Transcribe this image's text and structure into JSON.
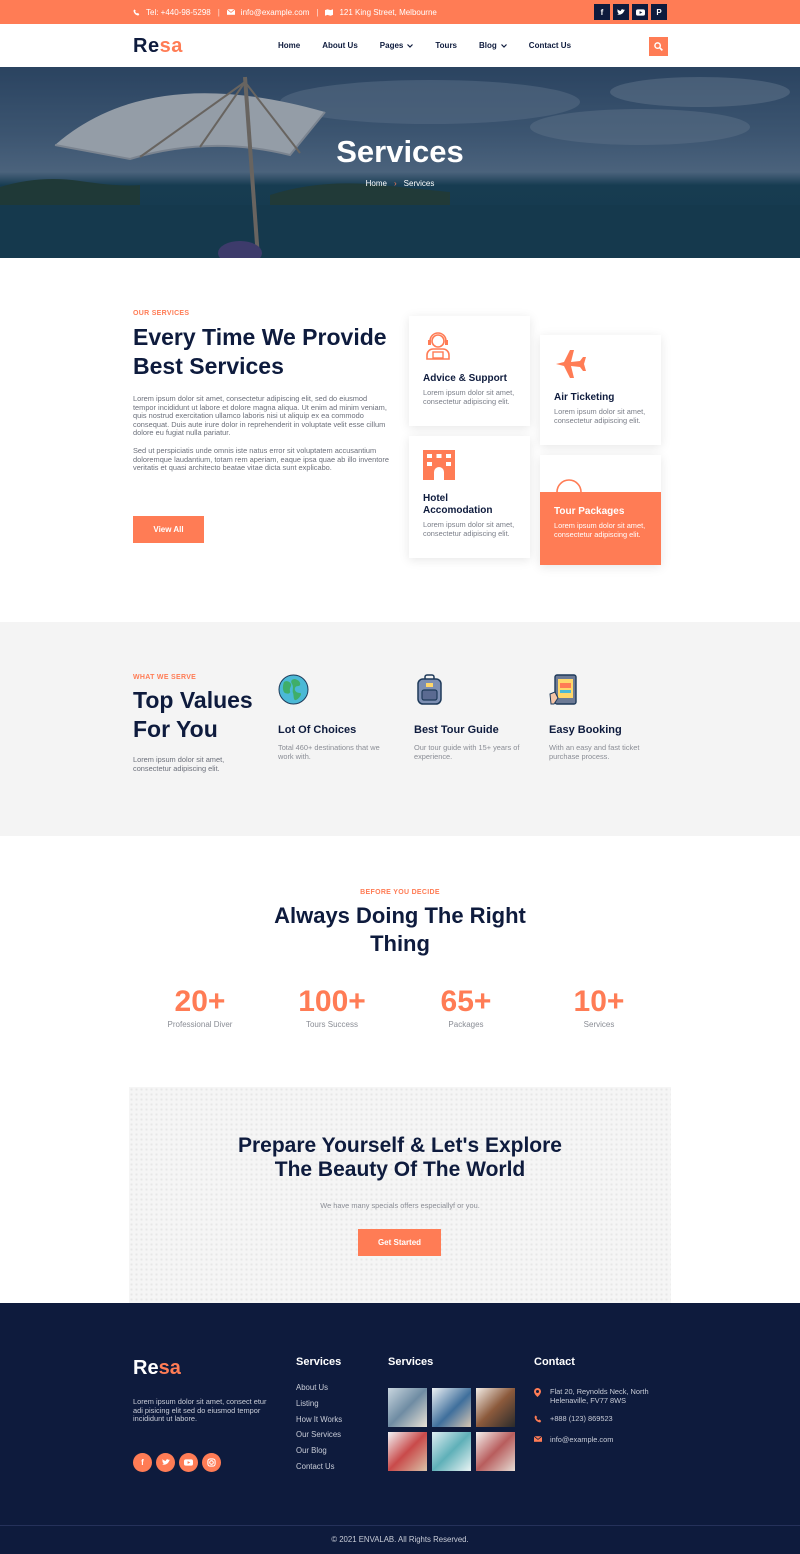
{
  "topbar": {
    "phone": "Tel: +440-98-5298",
    "email": "info@example.com",
    "address": "121 King Street, Melbourne",
    "socials": [
      "facebook-icon",
      "twitter-icon",
      "youtube-icon",
      "pinterest-icon"
    ]
  },
  "header": {
    "logo_a": "Re",
    "logo_b": "sa",
    "nav": [
      "Home",
      "About Us",
      "Pages",
      "Tours",
      "Blog",
      "Contact Us"
    ]
  },
  "hero": {
    "title": "Services",
    "breadcrumb_home": "Home",
    "breadcrumb_current": "Services"
  },
  "services": {
    "eyebrow": "OUR SERVICES",
    "title": "Every Time We Provide Best Services",
    "p1": "Lorem ipsum dolor sit amet, consectetur adipiscing elit, sed do eiusmod tempor incididunt ut labore et dolore magna aliqua. Ut enim ad minim veniam, quis nostrud exercitation ullamco laboris nisi ut aliquip ex ea commodo consequat. Duis aute irure dolor in reprehenderit in voluptate velit esse cillum dolore eu fugiat nulla pariatur.",
    "p2": "Sed ut perspiciatis unde omnis iste natus error sit voluptatem accusantium doloremque laudantium, totam rem aperiam, eaque ipsa quae ab illo inventore veritatis et quasi architecto beatae vitae dicta sunt explicabo.",
    "button": "View All",
    "cards": [
      {
        "title": "Advice & Support",
        "desc": "Lorem ipsum dolor sit amet, consectetur adipiscing elit."
      },
      {
        "title": "Air Ticketing",
        "desc": "Lorem ipsum dolor sit amet, consectetur adipiscing elit."
      },
      {
        "title": "Hotel Accomodation",
        "desc": "Lorem ipsum dolor sit amet, consectetur adipiscing elit."
      },
      {
        "title": "Tour Packages",
        "desc": "Lorem ipsum dolor sit amet, consectetur adipiscing elit."
      }
    ]
  },
  "values": {
    "eyebrow": "WHAT WE SERVE",
    "title": "Top Values For You",
    "desc": "Lorem ipsum dolor sit amet, consectetur adipiscing elit.",
    "items": [
      {
        "title": "Lot Of Choices",
        "desc": "Total 460+ destinations that we work with."
      },
      {
        "title": "Best Tour Guide",
        "desc": "Our tour guide with 15+ years of experience."
      },
      {
        "title": "Easy Booking",
        "desc": "With an easy and fast ticket purchase process."
      }
    ]
  },
  "stats": {
    "eyebrow": "BEFORE YOU DECIDE",
    "title": "Always Doing The Right Thing",
    "items": [
      {
        "num": "20+",
        "label": "Professional Diver"
      },
      {
        "num": "100+",
        "label": "Tours Success"
      },
      {
        "num": "65+",
        "label": "Packages"
      },
      {
        "num": "10+",
        "label": "Services"
      }
    ]
  },
  "cta": {
    "title_line1": "Prepare Yourself & Let's Explore",
    "title_line2": "The Beauty Of The World",
    "sub": "We have many specials offers especiallyf or you.",
    "button": "Get Started"
  },
  "footer": {
    "logo_a": "Re",
    "logo_b": "sa",
    "about": "Lorem ipsum dolor sit amet, consect etur adi pisicing elit sed do eiusmod tempor incididunt ut labore.",
    "links_title": "Services",
    "links": [
      "About Us",
      "Listing",
      "How It Works",
      "Our Services",
      "Our Blog",
      "Contact Us"
    ],
    "gallery_title": "Services",
    "contact_title": "Contact",
    "address": "Flat 20, Reynolds Neck, North Helenaville, FV77 8WS",
    "phone": "+888 (123) 869523",
    "email": "info@example.com",
    "copyright": "© 2021 ENVALAB. All Rights Reserved."
  },
  "colors": {
    "accent": "#ff7c55",
    "navy": "#0e1b3d"
  }
}
